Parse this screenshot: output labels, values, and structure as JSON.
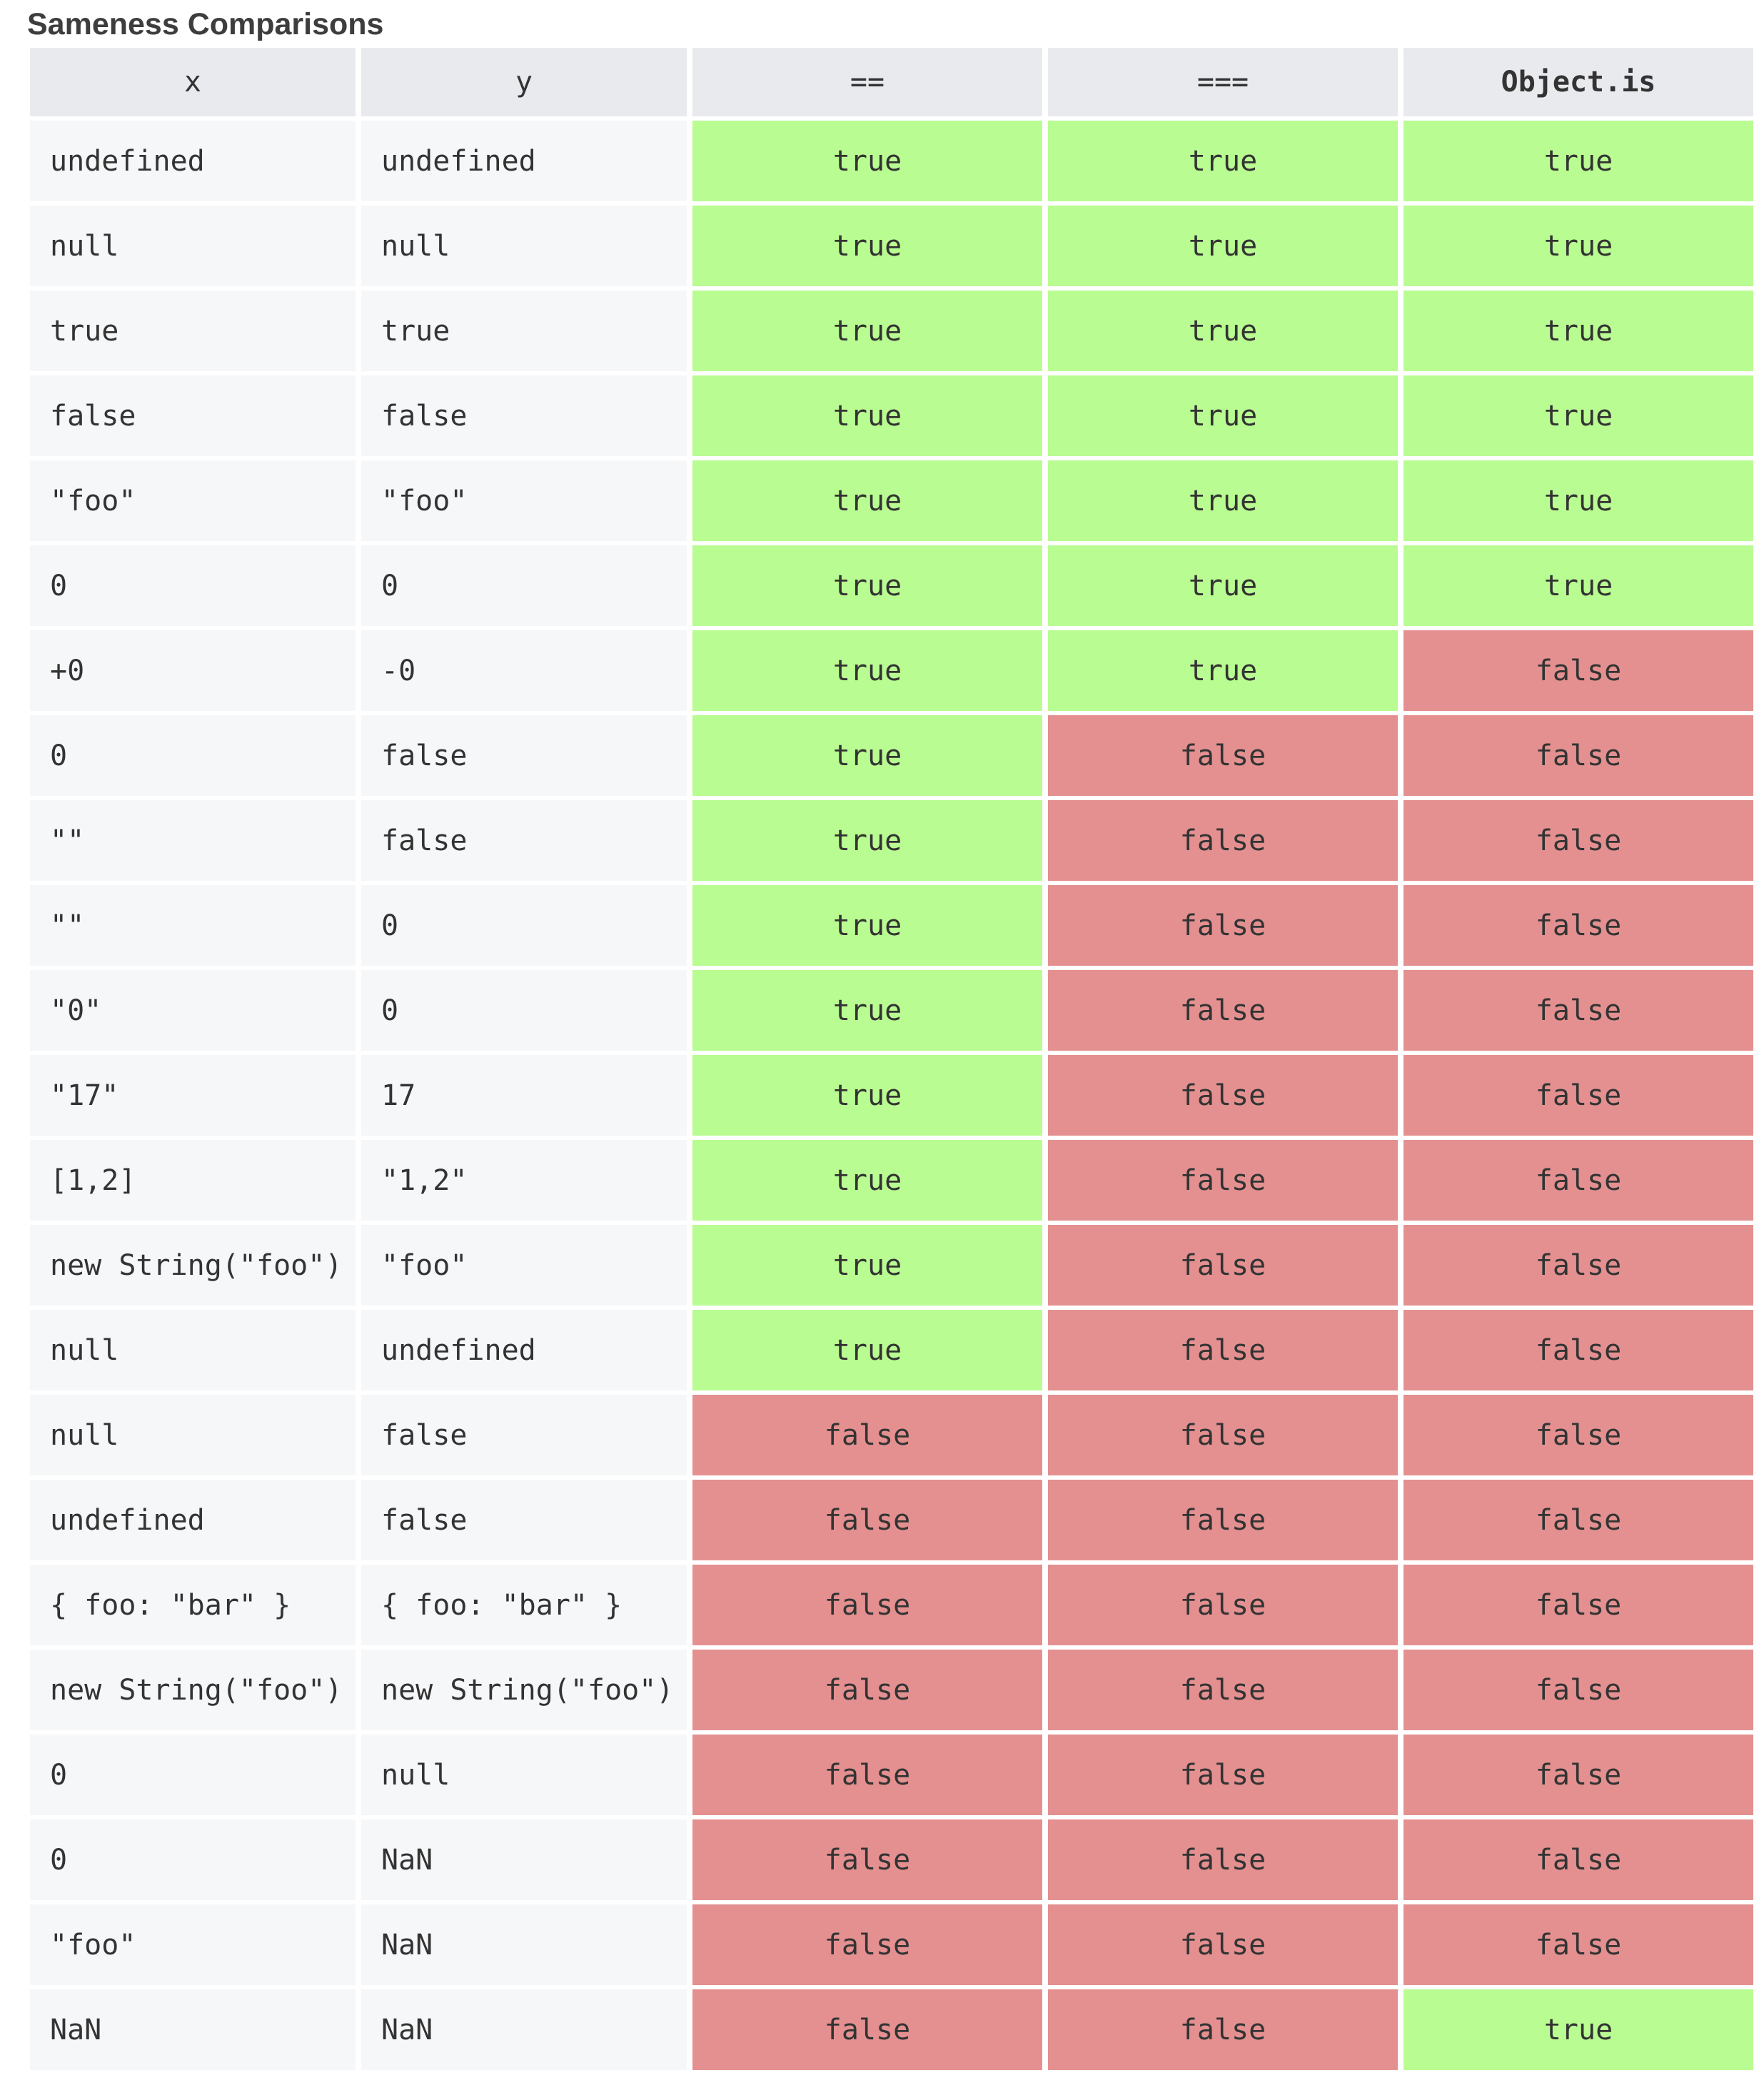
{
  "caption": "Sameness Comparisons",
  "colors": {
    "true_cell": "#b9fc91",
    "false_cell": "#e49090",
    "header": "#e9eaee",
    "value_cell": "#f6f7f9"
  },
  "headers": [
    "x",
    "y",
    "==",
    "===",
    "Object.is"
  ],
  "rows": [
    {
      "x": "undefined",
      "y": "undefined",
      "loose": "true",
      "strict": "true",
      "objectis": "true"
    },
    {
      "x": "null",
      "y": "null",
      "loose": "true",
      "strict": "true",
      "objectis": "true"
    },
    {
      "x": "true",
      "y": "true",
      "loose": "true",
      "strict": "true",
      "objectis": "true"
    },
    {
      "x": "false",
      "y": "false",
      "loose": "true",
      "strict": "true",
      "objectis": "true"
    },
    {
      "x": "\"foo\"",
      "y": "\"foo\"",
      "loose": "true",
      "strict": "true",
      "objectis": "true"
    },
    {
      "x": "0",
      "y": "0",
      "loose": "true",
      "strict": "true",
      "objectis": "true"
    },
    {
      "x": "+0",
      "y": "-0",
      "loose": "true",
      "strict": "true",
      "objectis": "false"
    },
    {
      "x": "0",
      "y": "false",
      "loose": "true",
      "strict": "false",
      "objectis": "false"
    },
    {
      "x": "\"\"",
      "y": "false",
      "loose": "true",
      "strict": "false",
      "objectis": "false"
    },
    {
      "x": "\"\"",
      "y": "0",
      "loose": "true",
      "strict": "false",
      "objectis": "false"
    },
    {
      "x": "\"0\"",
      "y": "0",
      "loose": "true",
      "strict": "false",
      "objectis": "false"
    },
    {
      "x": "\"17\"",
      "y": "17",
      "loose": "true",
      "strict": "false",
      "objectis": "false"
    },
    {
      "x": "[1,2]",
      "y": "\"1,2\"",
      "loose": "true",
      "strict": "false",
      "objectis": "false"
    },
    {
      "x": "new String(\"foo\")",
      "y": "\"foo\"",
      "loose": "true",
      "strict": "false",
      "objectis": "false"
    },
    {
      "x": "null",
      "y": "undefined",
      "loose": "true",
      "strict": "false",
      "objectis": "false"
    },
    {
      "x": "null",
      "y": "false",
      "loose": "false",
      "strict": "false",
      "objectis": "false"
    },
    {
      "x": "undefined",
      "y": "false",
      "loose": "false",
      "strict": "false",
      "objectis": "false"
    },
    {
      "x": "{ foo: \"bar\" }",
      "y": "{ foo: \"bar\" }",
      "loose": "false",
      "strict": "false",
      "objectis": "false"
    },
    {
      "x": "new String(\"foo\")",
      "y": "new String(\"foo\")",
      "loose": "false",
      "strict": "false",
      "objectis": "false"
    },
    {
      "x": "0",
      "y": "null",
      "loose": "false",
      "strict": "false",
      "objectis": "false"
    },
    {
      "x": "0",
      "y": "NaN",
      "loose": "false",
      "strict": "false",
      "objectis": "false"
    },
    {
      "x": "\"foo\"",
      "y": "NaN",
      "loose": "false",
      "strict": "false",
      "objectis": "false"
    },
    {
      "x": "NaN",
      "y": "NaN",
      "loose": "false",
      "strict": "false",
      "objectis": "true"
    }
  ]
}
